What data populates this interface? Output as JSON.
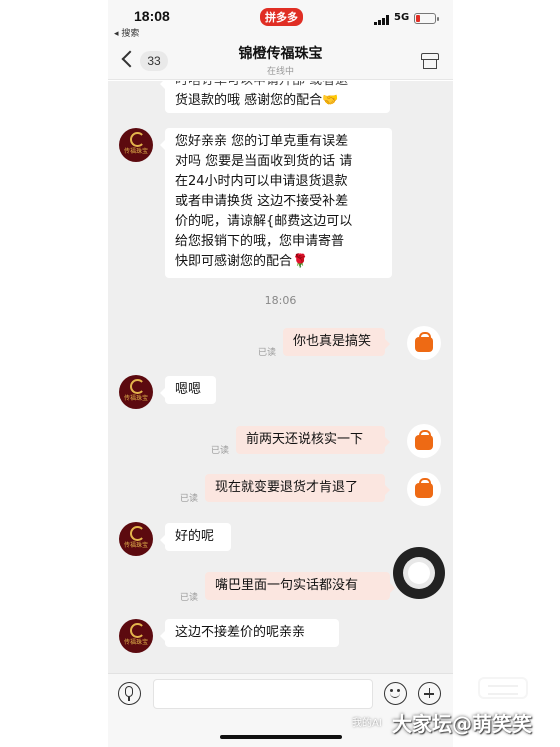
{
  "status_bar": {
    "time": "18:08",
    "back_app": "◂ 搜索",
    "app_badge": "拼多多",
    "network": "5G"
  },
  "header": {
    "unread_count": "33",
    "shop_name": "锦橙传福珠宝",
    "status": "在线中"
  },
  "messages": {
    "m0_line1": "时啥订单可以申请升部 或者退",
    "m0_line2": "货退款的哦 感谢您的配合🤝",
    "m1_lines": [
      "您好亲亲 您的订单克重有误差",
      "对吗 您要是当面收到货的话 请",
      "在24小时内可以申请退货退款",
      "或者申请换货 这边不接受补差",
      "价的呢，请谅解{邮费这边可以",
      "给您报销下的哦，您申请寄普",
      "快即可感谢您的配合🌹"
    ],
    "time_sep": "18:06",
    "m2": "你也真是搞笑",
    "m3": "嗯嗯",
    "m4": "前两天还说核实一下",
    "m5": "现在就变要退货才肯退了",
    "m6": "好的呢",
    "m7": "嘴巴里面一句实话都没有",
    "m8": "这边不接差价的呢亲亲",
    "read_label": "已读",
    "avatar_mark": "传福珠宝"
  },
  "input": {
    "placeholder": ""
  },
  "icons": {
    "back": "chevron-left-icon",
    "store": "store-icon",
    "mic": "microphone-icon",
    "emoji": "emoji-icon",
    "plus": "plus-icon",
    "user_avatar": "shopping-bag-icon"
  },
  "colors": {
    "brand_red": "#e02e24",
    "out_bubble": "#fbe6e0",
    "chat_bg": "#efefef",
    "avatar_bg": "#5c0a0f",
    "avatar_gold": "#e3b44c",
    "bag_orange": "#ee6a14"
  },
  "watermark": {
    "main": "大家坛@萌笑笑",
    "small": "我的AI"
  }
}
